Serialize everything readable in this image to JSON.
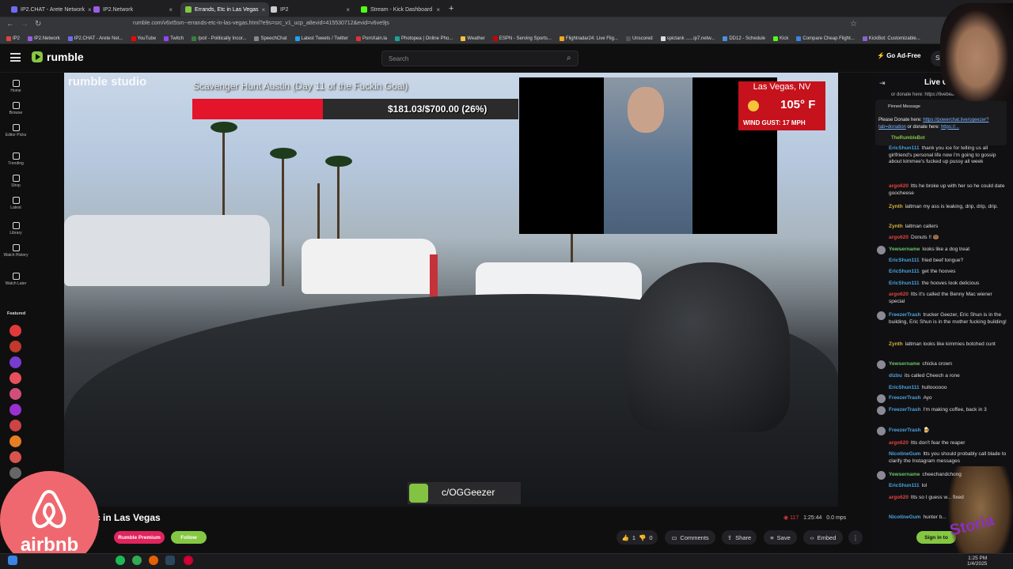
{
  "browser": {
    "tabs": [
      {
        "label": "IP2.CHAT - Arete Network",
        "color": "#6f6cf0"
      },
      {
        "label": "IP2.Network",
        "color": "#9b5de5"
      },
      {
        "label": "Errands, Etc in Las Vegas",
        "color": "#85c742"
      },
      {
        "label": "IP2",
        "color": "#cccccc"
      },
      {
        "label": "Stream - Kick Dashboard",
        "color": "#53fc18"
      }
    ],
    "url": "rumble.com/v6xt5sm--errands-etc-in-las-vegas.html?e9s=src_v1_ucp_a8evid=415530712&evid=v6ve9js",
    "bookmarks": [
      "IP2",
      "IP2.Network",
      "IP2.CHAT - Arete Net...",
      "YouTube",
      "Twitch",
      "/pol/ - Politically Incor...",
      "SpeechChat",
      "Latest Tweets / Twitter",
      "PornXain.la",
      "Photopea | Online Pho...",
      "Weather",
      "ESPN - Serving Sports...",
      "Flightradar24: Live Flig...",
      "Unscored",
      "spictank ......ip7.netw...",
      "DD12 - Schedule",
      "Kick",
      "Compare Cheap Flight...",
      "KickBot: Customizable..."
    ]
  },
  "header": {
    "logo": "rumble",
    "search_placeholder": "Search",
    "ad_free": "Go Ad-Free",
    "sign": "Sig"
  },
  "sidebar": {
    "items": [
      "Home",
      "Browse",
      "Editor Picks",
      "Trending",
      "Shop",
      "Latest",
      "Library",
      "Watch History",
      "Watch Later"
    ],
    "featured_label": "Featured"
  },
  "video": {
    "studio_label": "rumble studio",
    "stream_title": "Scavenger Hunt Austin (Day 11 of the Fuckin Goal)",
    "goal_text": "$181.03/$700.00 (26%)",
    "goal_fraction": 0.26,
    "weather_city": "Las Vegas, NV",
    "weather_temp": "105° F",
    "weather_gust": "WIND GUST:  17 MPH",
    "channel": "c/OGGeezer"
  },
  "below_video": {
    "title": "c in Las Vegas",
    "premium": "Rumble Premium",
    "follow": "Follow",
    "views": "117",
    "duration": "1:25:44",
    "bitrate": "0.0 mps",
    "likes": "1",
    "dislikes": "0",
    "actions": [
      "Comments",
      "Share",
      "Save",
      "Embed"
    ]
  },
  "chat": {
    "title": "Live C",
    "top_line": "or donate here: https://livebeam.chat/...",
    "pinned_header": "Pinned Message",
    "pinned_body_a": "Please Donate here: ",
    "pinned_link_a": "https://powerchat.live/ogeezer?tab=donation",
    "pinned_body_b": " or donate here: ",
    "pinned_link_b": "https://...",
    "pinned_user": "TheRumbleBot",
    "messages": [
      {
        "name": "EricShun111",
        "text": "thank you ice for telling us all girlfriend's personal life now i'm going to gossip about kimmee's fucked up pussy all week",
        "color": "#4aa3df"
      },
      {
        "name": "argo620",
        "text": "ltts he broke up with her so he could date goocheese",
        "color": "#e0443f"
      },
      {
        "name": "Zynth",
        "text": "laltman my ass is leaking, drip, drip, drip.",
        "color": "#d8b23b"
      },
      {
        "name": "Zynth",
        "text": "laltman callers",
        "color": "#d8b23b"
      },
      {
        "name": "argo620",
        "text": "Donuts !! 🍩",
        "color": "#e0443f"
      },
      {
        "name": "Yewsername",
        "text": "looks like a dog treat",
        "color": "#6ac46a"
      },
      {
        "name": "EricShun111",
        "text": "fried beef tongue?",
        "color": "#4aa3df"
      },
      {
        "name": "EricShun111",
        "text": "get the hooves",
        "color": "#4aa3df"
      },
      {
        "name": "EricShun111",
        "text": "the hooves look delicious",
        "color": "#4aa3df"
      },
      {
        "name": "argo620",
        "text": "ltts it's called the Benny Mac wiener special",
        "color": "#e0443f"
      },
      {
        "name": "FreezerTrash",
        "text": "trucker Geezer, Eric Shun is in the building, Eric Shun is in the mother fucking building!",
        "color": "#4aa3df"
      },
      {
        "name": "Zynth",
        "text": "laltman looks like kimmies botched cunt",
        "color": "#d8b23b"
      },
      {
        "name": "Yewsername",
        "text": "chicka crown",
        "color": "#6ac46a"
      },
      {
        "name": "dizbu",
        "text": "its called Cheech a rone",
        "color": "#4aa3df"
      },
      {
        "name": "EricShun111",
        "text": "hulloooooo",
        "color": "#4aa3df"
      },
      {
        "name": "FreezerTrash",
        "text": "Ayo",
        "color": "#4aa3df"
      },
      {
        "name": "FreezerTrash",
        "text": "I'm making coffee, back in 3",
        "color": "#4aa3df"
      },
      {
        "name": "FreezerTrash",
        "text": "🍺",
        "color": "#4aa3df"
      },
      {
        "name": "argo620",
        "text": "ltts don't fear the reaper",
        "color": "#e0443f"
      },
      {
        "name": "NicotineGum",
        "text": "ltts you should probably call blade to clarify the Instagram messages",
        "color": "#4aa3df"
      },
      {
        "name": "Yewsername",
        "text": "cheechandchong",
        "color": "#6ac46a"
      },
      {
        "name": "EricShun111",
        "text": "lol",
        "color": "#4aa3df"
      },
      {
        "name": "argo620",
        "text": "ltts so I guess w... fixed",
        "color": "#e0443f"
      },
      {
        "name": "NicotineGum",
        "text": "hunter b...",
        "color": "#4aa3df"
      }
    ],
    "signin": "Sign in to"
  },
  "overlays": {
    "airbnb": "airbnb",
    "wookie_text": "Storia"
  },
  "taskbar": {
    "time": "1:25 PM",
    "date": "1/4/2025"
  }
}
